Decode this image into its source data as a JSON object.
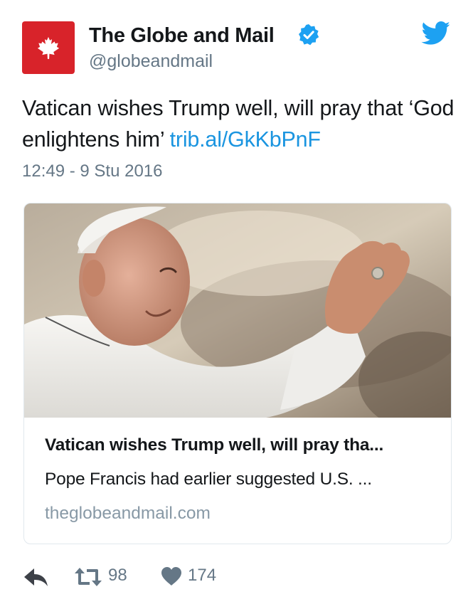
{
  "colors": {
    "brand_red": "#d8232a",
    "link_blue": "#1b95e0",
    "twitter_blue": "#1da1f2",
    "secondary_text": "#657786",
    "primary_text": "#14171a"
  },
  "account": {
    "avatar_icon": "maple-leaf-icon",
    "display_name": "The Globe and Mail",
    "verified_icon": "verified-badge-icon",
    "handle": "@globeandmail",
    "platform_icon": "twitter-bird-icon"
  },
  "tweet": {
    "text": "Vatican wishes Trump well, will pray that ‘God enlightens him’ ",
    "link": "trib.al/GkKbPnF",
    "timestamp": "12:49 - 9 Stu 2016"
  },
  "card": {
    "image_icon": "photo-pope-waving",
    "title": "Vatican wishes Trump well, will pray tha...",
    "description": "Pope Francis had earlier suggested U.S. ...",
    "domain": "theglobeandmail.com"
  },
  "actions": {
    "reply_icon": "reply-icon",
    "retweet_icon": "retweet-icon",
    "retweet_count": "98",
    "like_icon": "heart-icon",
    "like_count": "174"
  }
}
